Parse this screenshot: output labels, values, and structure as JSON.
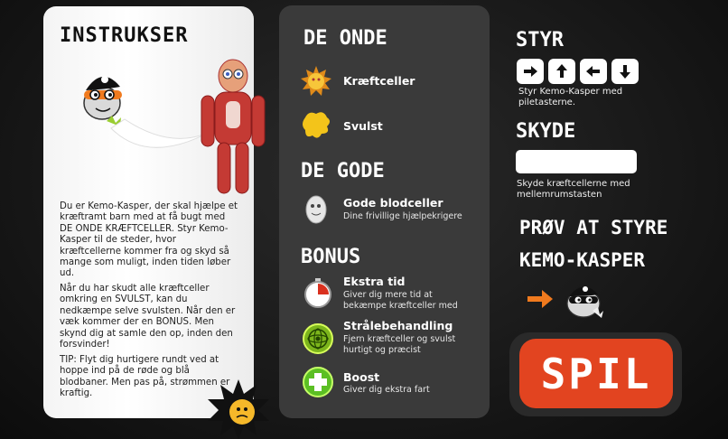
{
  "instructions": {
    "title": "INSTRUKSER",
    "para1": "Du er Kemo-Kasper, der skal hjælpe et kræftramt barn med at få bugt med DE ONDE KRÆFTCELLER. Styr Kemo-Kasper til de steder, hvor kræftcellerne kommer fra og skyd så mange som muligt, inden tiden løber ud.",
    "para2": "Når du har skudt alle kræftceller omkring en SVULST, kan du nedkæmpe selve svulsten. Når den er væk kommer der en BONUS. Men skynd dig at samle den op, inden den forsvinder!",
    "para3": "TIP: Flyt dig hurtigere rundt ved at hoppe ind på de røde og blå blodbaner. Men pas på, strømmen er kraftig."
  },
  "bad": {
    "title": "DE ONDE",
    "items": [
      {
        "label": "Kræftceller",
        "icon": "cancer-cell-icon"
      },
      {
        "label": "Svulst",
        "icon": "tumor-icon"
      }
    ]
  },
  "good": {
    "title": "DE GODE",
    "items": [
      {
        "label": "Gode blodceller",
        "sub": "Dine frivillige hjælpekrigere",
        "icon": "white-blood-cell-icon"
      }
    ]
  },
  "bonus": {
    "title": "BONUS",
    "items": [
      {
        "label": "Ekstra tid",
        "sub": "Giver dig mere tid at bekæmpe kræftceller med",
        "icon": "stopwatch-icon"
      },
      {
        "label": "Strålebehandling",
        "sub": "Fjern kræftceller og svulst hurtigt og præcist",
        "icon": "radiation-icon"
      },
      {
        "label": "Boost",
        "sub": "Giver dig ekstra fart",
        "icon": "plus-boost-icon"
      }
    ]
  },
  "controls": {
    "steer_title": "STYR",
    "steer_text": "Styr Kemo-Kasper med piletasterne.",
    "shoot_title": "SKYDE",
    "shoot_text": "Skyde kræftcellerne med mellemrumstasten",
    "try_title_line1": "PRØV AT STYRE",
    "try_title_line2": "KEMO-KASPER",
    "keys": [
      "arrow-right-icon",
      "arrow-up-icon",
      "arrow-left-icon",
      "arrow-down-icon"
    ]
  },
  "play": {
    "label": "SPIL"
  },
  "colors": {
    "accent": "#e24420",
    "panel": "#3a3a3a",
    "arrow": "#f07a1e"
  }
}
